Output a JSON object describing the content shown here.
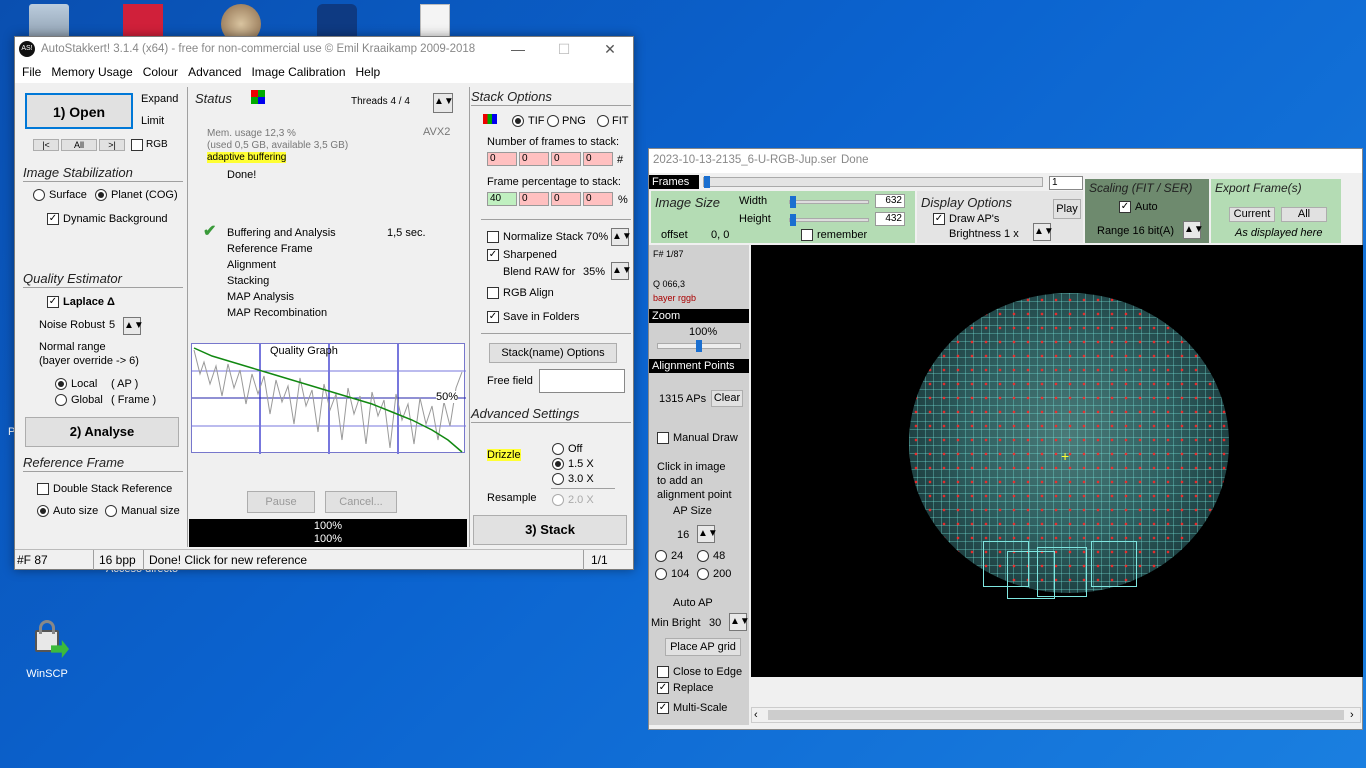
{
  "desktop": {
    "icons": [
      {
        "label": "",
        "name": "recycle-bin-icon"
      },
      {
        "label": "",
        "name": "red-app-icon"
      },
      {
        "label": "",
        "name": "jupiter-icon"
      },
      {
        "label": "",
        "name": "teamviewer-icon"
      },
      {
        "label": "",
        "name": "document-icon"
      },
      {
        "label": "WinSCP",
        "name": "winscp-icon"
      }
    ],
    "partial_text": "Acceso directo",
    "left_edge_letter": "P"
  },
  "main": {
    "title": "AutoStakkert! 3.1.4 (x64) - free for non-commercial use © Emil Kraaikamp 2009-2018",
    "menu": [
      "File",
      "Memory Usage",
      "Colour",
      "Advanced",
      "Image Calibration",
      "Help"
    ],
    "left": {
      "open_label": "1) Open",
      "expand": "Expand",
      "limit": "Limit",
      "nav": [
        "|<",
        "All",
        ">|"
      ],
      "rgb": "RGB",
      "stab_title": "Image Stabilization",
      "surface": "Surface",
      "planet": "Planet (COG)",
      "dynbg": "Dynamic Background",
      "qe_title": "Quality Estimator",
      "laplace": "Laplace Δ",
      "noise": "Noise Robust",
      "noise_val": "5",
      "normal_range": "Normal range",
      "bayer": "(bayer override -> 6)",
      "local": "Local",
      "local_ap": "( AP )",
      "global": "Global",
      "global_frame": "( Frame )",
      "analyse": "2) Analyse",
      "ref_title": "Reference Frame",
      "double_stack": "Double Stack Reference",
      "autosize": "Auto size",
      "manualsize": "Manual size"
    },
    "status": {
      "title": "Status",
      "threads": "Threads 4 / 4",
      "mem": "Mem. usage 12,3 %",
      "mem2": "(used 0,5 GB, available 3,5 GB)",
      "avx": "AVX2",
      "adaptive": "adaptive buffering",
      "done": "Done!",
      "steps": [
        "Buffering and Analysis",
        "Reference Frame",
        "Alignment",
        "Stacking",
        "MAP Analysis",
        "MAP Recombination"
      ],
      "buffer_time": "1,5 sec.",
      "graph_title": "Quality Graph",
      "graph_pct": "50%",
      "pause": "Pause",
      "cancel": "Cancel...",
      "prog1": "100%",
      "prog2": "100%"
    },
    "stack": {
      "title": "Stack Options",
      "tif": "TIF",
      "png": "PNG",
      "fit": "FIT",
      "nframes_label": "Number of frames to stack:",
      "nframes": [
        "0",
        "0",
        "0",
        "0"
      ],
      "hash": "#",
      "pct_label": "Frame percentage to stack:",
      "pct": [
        "40",
        "0",
        "0",
        "0"
      ],
      "pct_sym": "%",
      "normalize": "Normalize Stack 70%",
      "sharpened": "Sharpened",
      "blend": "Blend RAW for",
      "blend_val": "35%",
      "rgb_align": "RGB Align",
      "save_folders": "Save in Folders",
      "stackname": "Stack(name) Options",
      "free_field": "Free field",
      "adv_title": "Advanced Settings",
      "drizzle": "Drizzle",
      "off": "Off",
      "x15": "1.5 X",
      "x30": "3.0 X",
      "resample": "Resample",
      "x20": "2.0 X",
      "stack_btn": "3) Stack"
    },
    "statusbar": {
      "frames": "#F 87",
      "bpp": "16 bpp",
      "msg": "Done! Click for new reference",
      "page": "1/1"
    }
  },
  "viewer": {
    "title": "2023-10-13-2135_6-U-RGB-Jup.ser",
    "title_status": "Done",
    "frames_label": "Frames",
    "frame_val": "1",
    "frame_fraction": 0.0,
    "imgsize_title": "Image Size",
    "width_label": "Width",
    "width_val": "632",
    "height_label": "Height",
    "height_val": "432",
    "offset_label": "offset",
    "offset_val": "0, 0",
    "remember": "remember",
    "disp_title": "Display Options",
    "draw_aps": "Draw AP's",
    "play": "Play",
    "brightness": "Brightness  1 x",
    "scaling_title": "Scaling (FIT / SER)",
    "auto": "Auto",
    "range": "Range 16 bit(A)",
    "export_title": "Export Frame(s)",
    "current": "Current",
    "all": "All",
    "as_displayed": "As displayed here",
    "frame_info": "F# 1/87",
    "quality": "Q  066,3",
    "bayer": "bayer rggb",
    "zoom_title": "Zoom",
    "zoom_val": "100%",
    "ap_title": "Alignment Points",
    "ap_count": "1315 APs",
    "clear": "Clear",
    "manual_draw": "Manual Draw",
    "click_hint": [
      "Click in image",
      "to add an",
      "alignment point"
    ],
    "ap_size_title": "AP Size",
    "ap_size_val": "16",
    "sizes": [
      "24",
      "48",
      "104",
      "200"
    ],
    "auto_ap": "Auto AP",
    "min_bright": "Min Bright",
    "min_bright_val": "30",
    "place_grid": "Place AP grid",
    "close_edge": "Close to Edge",
    "replace": "Replace",
    "multiscale": "Multi-Scale"
  }
}
